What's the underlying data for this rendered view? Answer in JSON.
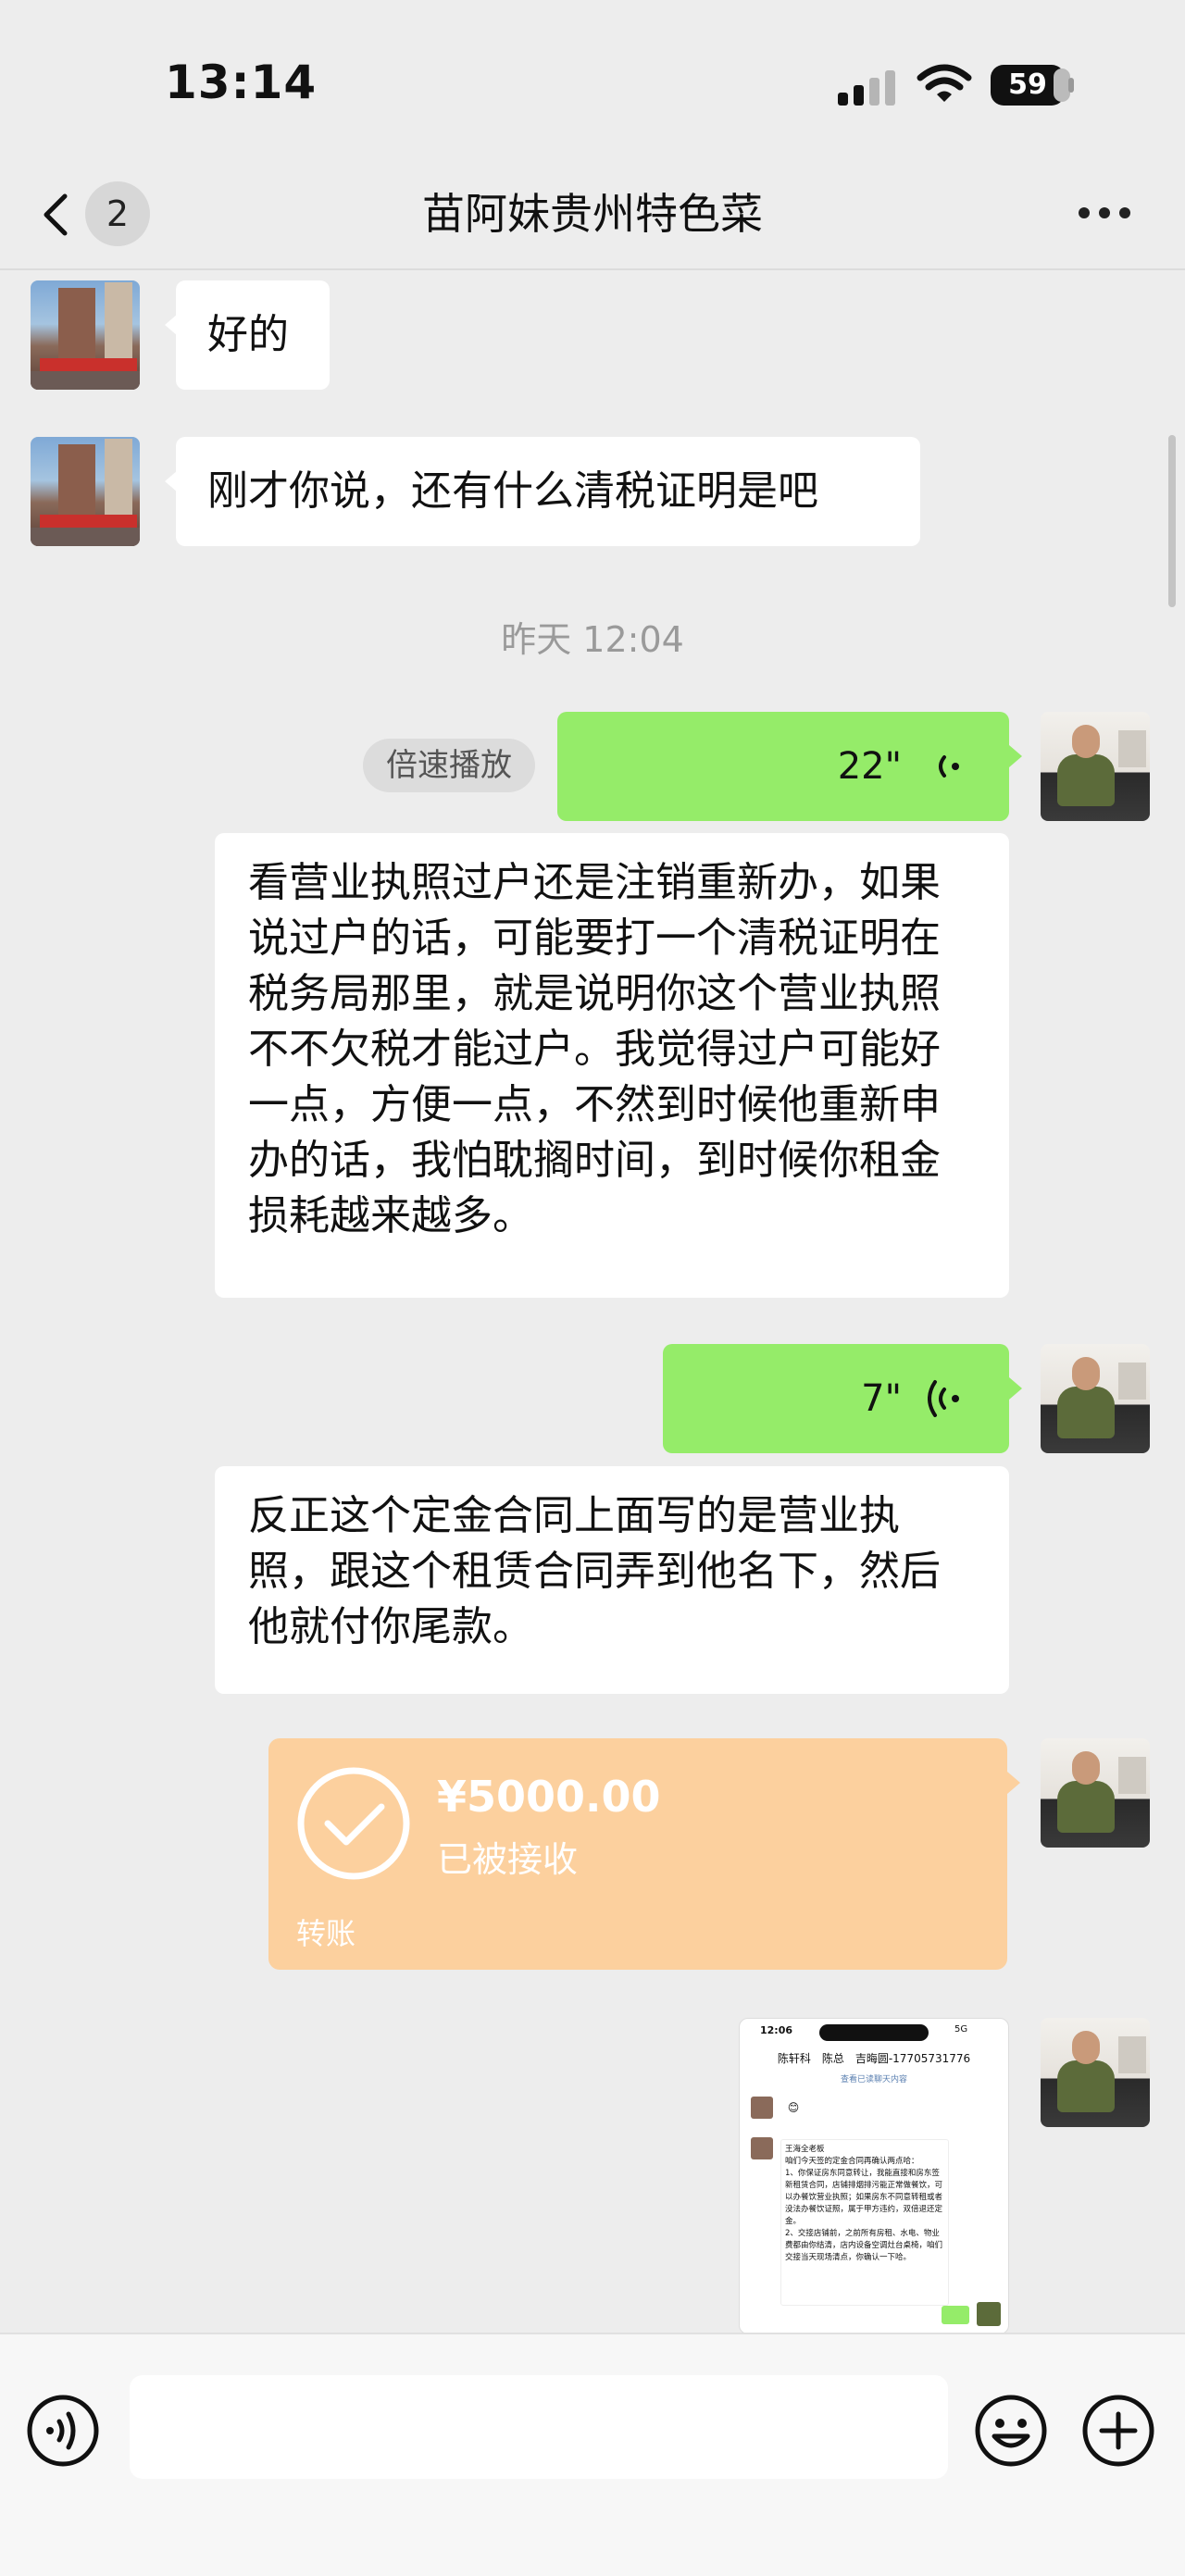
{
  "status_bar": {
    "time": "13:14",
    "battery": "59"
  },
  "nav": {
    "unread_count": "2",
    "title": "苗阿妹贵州特色菜"
  },
  "messages": {
    "m1": "好的",
    "m2": "刚才你说，还有什么清税证明是吧",
    "timestamp": "昨天 12:04",
    "speed_play": "倍速播放",
    "voice1": {
      "duration": "22\""
    },
    "transcript1": "看营业执照过户还是注销重新办，如果说过户的话，可能要打一个清税证明在税务局那里，就是说明你这个营业执照不不欠税才能过户。我觉得过户可能好一点，方便一点，不然到时候他重新申办的话，我怕耽搁时间，到时候你租金损耗越来越多。",
    "voice2": {
      "duration": "7\""
    },
    "transcript2": "反正这个定金合同上面写的是营业执照，跟这个租赁合同弄到他名下，然后他就付你尾款。",
    "transfer": {
      "amount": "¥5000.00",
      "status": "已被接收",
      "label": "转账"
    }
  },
  "thumbnail": {
    "time": "12:06",
    "signal": "5G",
    "title": "陈轩科　陈总　吉晦圆-17705731776",
    "subtitle": "查看已读聊天内容",
    "emoji": "😊",
    "text": "王海全老板\n咱们今天签的定金合同再确认两点哈：\n1、你保证房东同意转让，我能直接和房东签新租赁合同，店铺排烟排污能正常做餐饮，可以办餐饮营业执照；如果房东不同意转租或者没法办餐饮证照，属于甲方违约，双倍退还定金。\n2、交接店铺前，之前所有房租、水电、物业费都由你结清，店内设备空调灶台桌椅，咱们交接当天现场清点，你确认一下哈。"
  },
  "icons": {
    "back": "chevron-left-icon",
    "more": "more-horizontal-icon",
    "voice": "voice-wave-icon",
    "check": "check-circle-icon",
    "voice_input": "voice-input-icon",
    "emoji": "smiley-icon",
    "plus": "plus-circle-icon"
  },
  "colors": {
    "background": "#ededed",
    "bubble_sent": "#95ec69",
    "bubble_received": "#ffffff",
    "transfer_card": "#fcd09e"
  }
}
